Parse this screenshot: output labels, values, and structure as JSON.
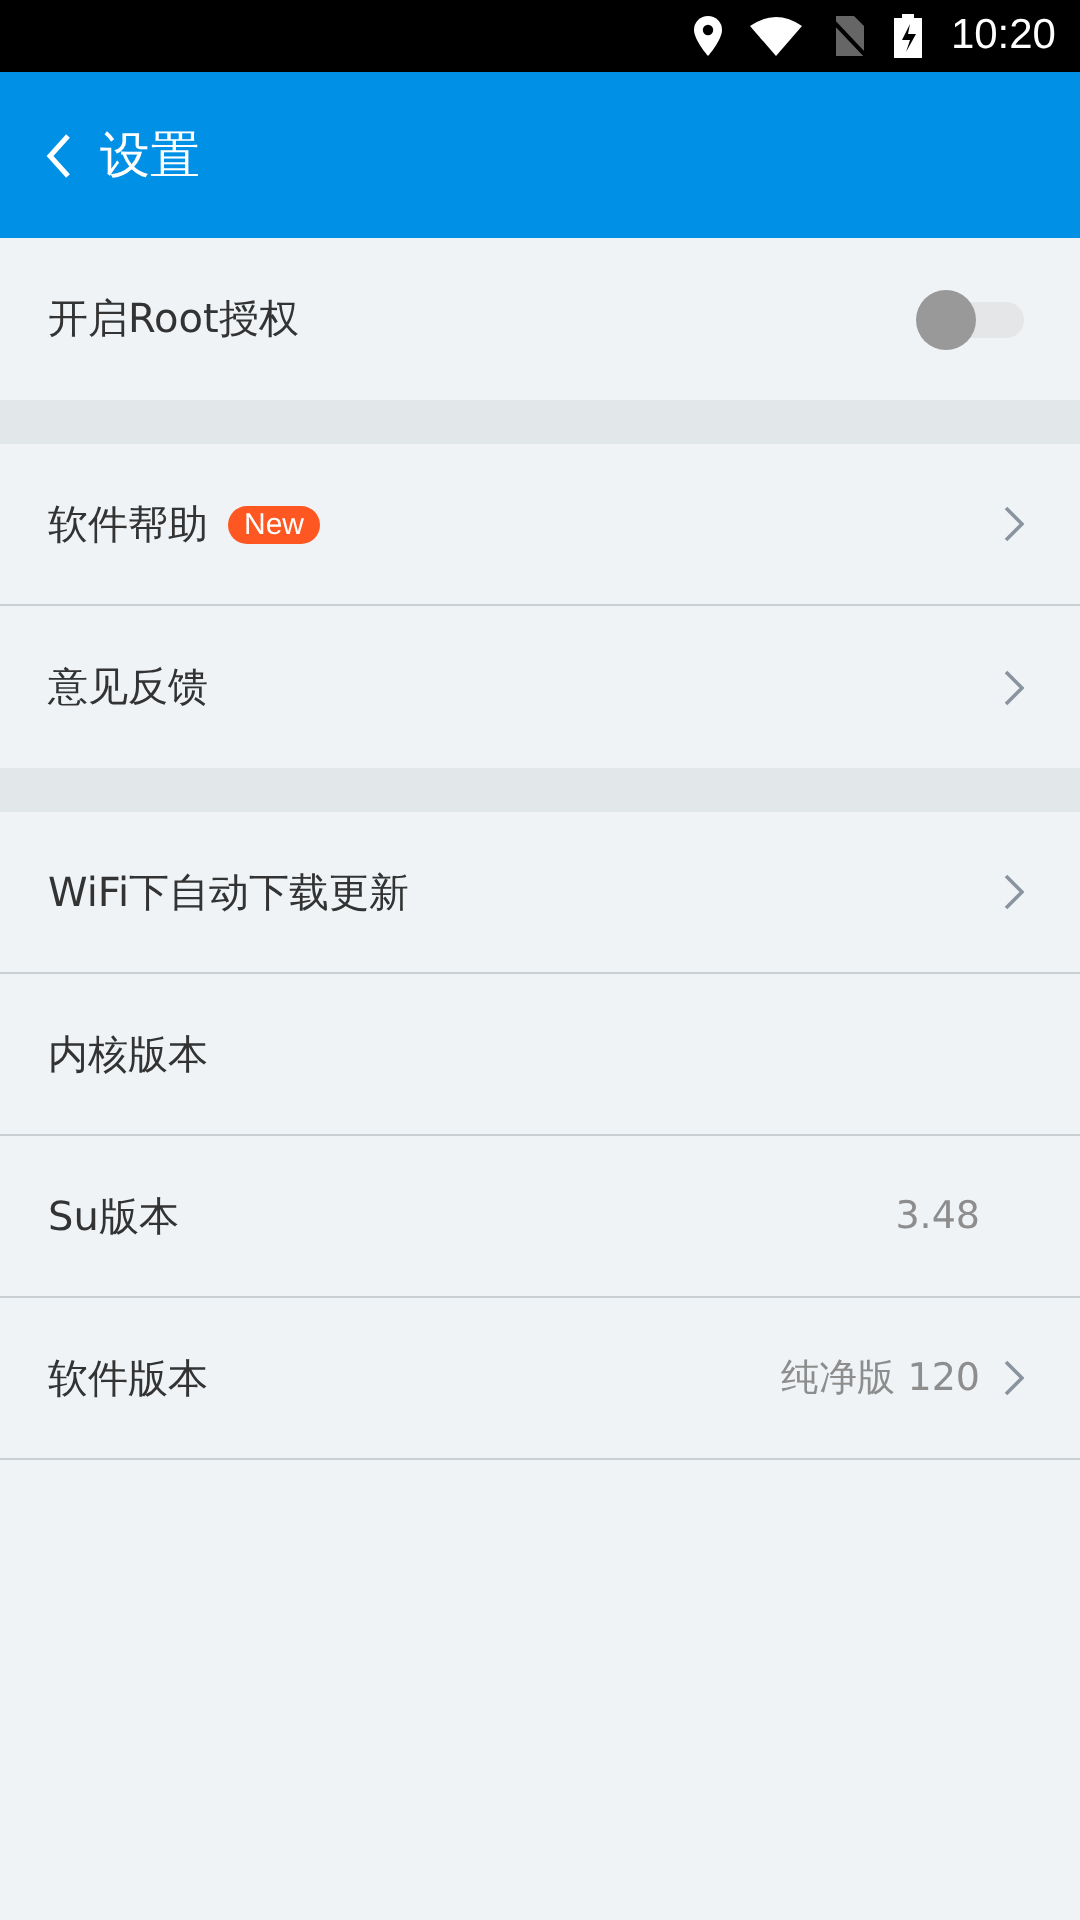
{
  "status_bar": {
    "time": "10:20"
  },
  "header": {
    "title": "设置"
  },
  "sections": [
    {
      "rows": [
        {
          "kind": "toggle",
          "label": "开启Root授权",
          "on": false
        }
      ]
    },
    {
      "rows": [
        {
          "kind": "link",
          "label": "软件帮助",
          "badge": "New"
        },
        {
          "kind": "link",
          "label": "意见反馈"
        }
      ]
    },
    {
      "rows": [
        {
          "kind": "link",
          "label": "WiFi下自动下载更新"
        },
        {
          "kind": "info",
          "label": "内核版本"
        },
        {
          "kind": "info",
          "label": "Su版本",
          "value": "3.48"
        },
        {
          "kind": "link",
          "label": "软件版本",
          "value": "纯净版 120"
        }
      ]
    }
  ]
}
